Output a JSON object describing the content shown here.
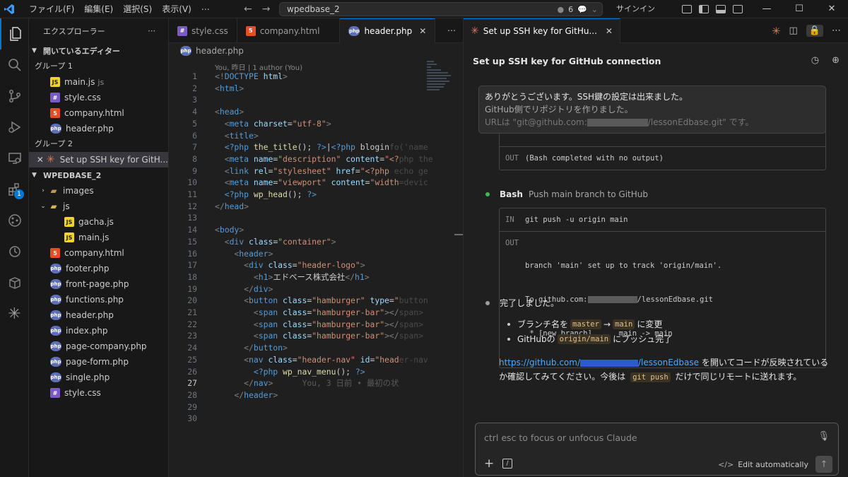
{
  "titlebar": {
    "menu": [
      "ファイル(F)",
      "編集(E)",
      "選択(S)",
      "表示(V)"
    ],
    "more": "⋯",
    "search": "wpedbase_2",
    "changes_count": "6",
    "signin": "サインイン"
  },
  "sidebar": {
    "header": "エクスプローラー",
    "open_editors": "開いているエディター",
    "group1": "グループ 1",
    "group1_items": [
      {
        "name": "main.js",
        "hint": "js",
        "type": "js"
      },
      {
        "name": "style.css",
        "type": "css"
      },
      {
        "name": "company.html",
        "type": "html"
      },
      {
        "name": "header.php",
        "type": "php"
      }
    ],
    "group2": "グループ 2",
    "group2_item": "Set up SSH key for GitH...",
    "project": "WPEDBASE_2",
    "tree": [
      {
        "name": "images",
        "type": "folder"
      },
      {
        "name": "js",
        "type": "folder-open"
      },
      {
        "name": "gacha.js",
        "type": "js"
      },
      {
        "name": "main.js",
        "type": "js"
      },
      {
        "name": "company.html",
        "type": "html"
      },
      {
        "name": "footer.php",
        "type": "php"
      },
      {
        "name": "front-page.php",
        "type": "php"
      },
      {
        "name": "functions.php",
        "type": "php"
      },
      {
        "name": "header.php",
        "type": "php"
      },
      {
        "name": "index.php",
        "type": "php"
      },
      {
        "name": "page-company.php",
        "type": "php"
      },
      {
        "name": "page-form.php",
        "type": "php"
      },
      {
        "name": "single.php",
        "type": "php"
      },
      {
        "name": "style.css",
        "type": "css"
      }
    ],
    "scm_badge": "1"
  },
  "editor": {
    "tabs": [
      "style.css",
      "company.html",
      "header.php"
    ],
    "active_tab": "header.php",
    "breadcrumb": "header.php",
    "blame": "You, 昨日 | 1 author (You)",
    "inline_blame": "You, 3 日前 • 最初の状態",
    "current_line": 27
  },
  "claude": {
    "tab_title": "Set up SSH key for GitHu...",
    "conversation_title": "Set up SSH key for GitHub connection",
    "user_message": {
      "line1": "ありがとうございます。SSH鍵の設定は出来ました。",
      "line2": "GitHub側でリポジトリを作りました。",
      "line3_prefix": "URLは \"git@github.com:",
      "line3_suffix": "/lessonEdbase.git\" です。"
    },
    "prev_output": {
      "label": "OUT",
      "text": "(Bash completed with no output)"
    },
    "bash_step": {
      "tool": "Bash",
      "description": "Push main branch to GitHub"
    },
    "bash_in": {
      "label": "IN",
      "command": "git push -u origin main"
    },
    "bash_out": {
      "label": "OUT",
      "line1": "branch 'main' set up to track 'origin/main'.",
      "line2_prefix": "To github.com:",
      "line2_suffix": "/lessonEdbase.git",
      "line3": " * [new branch]      main -> main"
    },
    "done": "完了しました。",
    "bullet1": {
      "prefix": "ブランチ名を",
      "code1": "master",
      "arrow": "→",
      "code2": "main",
      "suffix": "に変更"
    },
    "bullet2": {
      "prefix": "GitHubの",
      "code": "origin/main",
      "suffix": "にプッシュ完了"
    },
    "para": {
      "link_prefix": "https://github.com/",
      "link_suffix": "/lessonEdbase",
      "text1": " を開いてコードが反映されているか確認してみてください。今後は ",
      "code": "git push",
      "text2": " だけで同じリモートに送れます。"
    },
    "input_placeholder": "ctrl esc to focus or unfocus Claude",
    "edit_mode": "Edit automatically"
  },
  "colors": {
    "accent": "#0078d4",
    "claude": "#e07a5f",
    "step_done": "#3fb950"
  }
}
